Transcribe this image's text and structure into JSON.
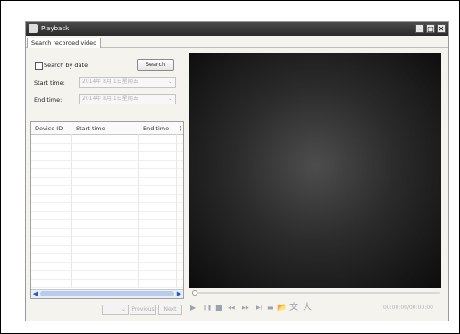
{
  "window": {
    "title": "Playback"
  },
  "tabs": [
    {
      "label": "Search recorded video"
    }
  ],
  "search": {
    "by_date_label": "Search by date",
    "search_button": "Search",
    "start_label": "Start time:",
    "start_value": "2014年 8月 1日星期五",
    "end_label": "End time:",
    "end_value": "2014年 8月 1日星期五"
  },
  "table": {
    "columns": [
      "Device ID",
      "Start time",
      "End time",
      "("
    ]
  },
  "pager": {
    "page_select": "",
    "previous_label": "Previous",
    "next_label": "Next"
  },
  "player": {
    "timecode": "00:00:00/00:00:00"
  },
  "icons": {
    "play": "▶",
    "pause": "❚❚",
    "stop": "■",
    "rewind": "◀◀",
    "fast_forward": "▶▶",
    "step": "▶|",
    "snapshot": "▬",
    "folder": "📂",
    "text": "文",
    "person": "人"
  }
}
